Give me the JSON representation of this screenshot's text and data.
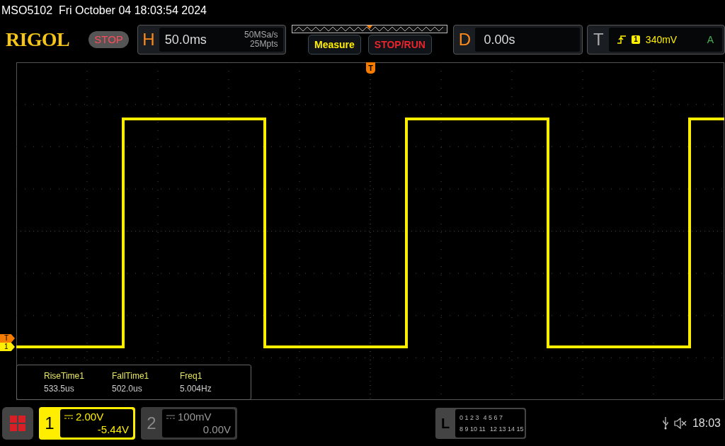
{
  "header": {
    "title": "MSO5102  Fri October 04 18:03:54 2024"
  },
  "logo": "RIGOL",
  "run_state": {
    "label": "STOP"
  },
  "horizontal": {
    "letter": "H",
    "timebase": "50.0ms",
    "sample_rate": "50MSa/s",
    "memory_depth": "25Mpts"
  },
  "buttons": [
    {
      "label": "Measure",
      "kind": "measure"
    },
    {
      "label": "STOP/RUN",
      "kind": "stoprun"
    }
  ],
  "delay": {
    "letter": "D",
    "value": "0.00s"
  },
  "trigger": {
    "letter": "T",
    "source": "1",
    "level": "340mV",
    "mode": "A"
  },
  "trigger_position_marker": {
    "label": "T"
  },
  "side_markers": [
    {
      "label": "T",
      "color": "#f57c00"
    },
    {
      "label": "1",
      "color": "#ffee00"
    }
  ],
  "measurements": [
    {
      "name": "RiseTime1",
      "value": "533.5us"
    },
    {
      "name": "FallTime1",
      "value": "502.0us"
    },
    {
      "name": "Freq1",
      "value": "5.004Hz"
    }
  ],
  "channels": [
    {
      "number": "1",
      "scale": "2.00V",
      "offset": "-5.44V",
      "selected": true
    },
    {
      "number": "2",
      "scale": "100mV",
      "offset": "0.00V",
      "selected": false
    }
  ],
  "logic": {
    "letter": "L",
    "rows": [
      [
        "0 1 2 3",
        "4 5 6 7"
      ],
      [
        "8 9 10 11",
        "12 13 14 15"
      ]
    ]
  },
  "status": {
    "time": "18:03"
  }
}
